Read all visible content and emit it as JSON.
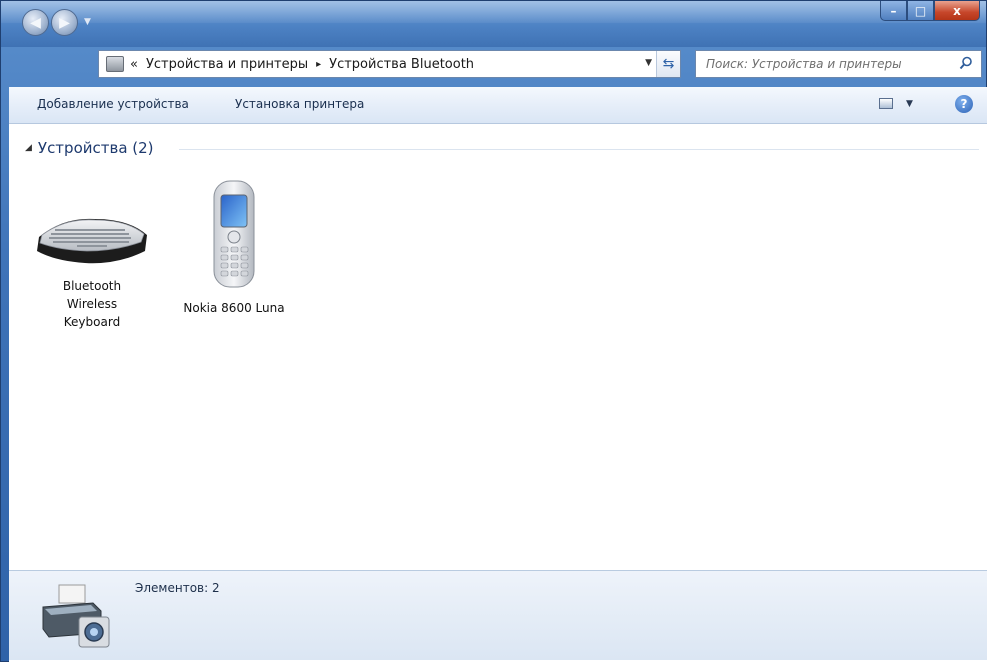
{
  "window": {
    "controls": {
      "minimize": "–",
      "maximize": "□",
      "close": "x"
    }
  },
  "nav": {
    "back_icon": "back-arrow-icon",
    "forward_icon": "forward-arrow-icon"
  },
  "address": {
    "prefix": "«",
    "segments": [
      "Устройства и принтеры",
      "Устройства Bluetooth"
    ],
    "separator": "▸"
  },
  "search": {
    "placeholder": "Поиск: Устройства и принтеры"
  },
  "toolbar": {
    "add_device": "Добавление устройства",
    "install_printer": "Установка принтера",
    "help": "?"
  },
  "group": {
    "title": "Устройства (2)"
  },
  "devices": [
    {
      "label": "Bluetooth Wireless Keyboard",
      "icon": "keyboard-icon"
    },
    {
      "label": "Nokia 8600 Luna",
      "icon": "mobile-phone-icon"
    }
  ],
  "statusbar": {
    "items_text": "Элементов: 2",
    "icon": "devices-and-printers-icon"
  },
  "colors": {
    "window_frame": "#3f73b8",
    "toolbar_bg": "#e6eef9",
    "group_title": "#1e3a6e"
  }
}
